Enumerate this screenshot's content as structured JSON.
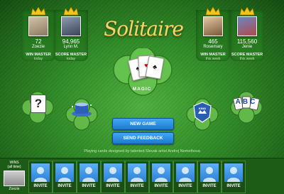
{
  "leaderboard": [
    {
      "score": "72",
      "name": "Zoezie",
      "title": "WIN MASTER",
      "sub": "today"
    },
    {
      "score": "94,965",
      "name": "Lynn M.",
      "title": "SCORE MASTER",
      "sub": "today"
    },
    {
      "score": "465",
      "name": "Rosemary",
      "title": "WIN MASTER",
      "sub": "this week"
    },
    {
      "score": "115,560",
      "name": "Jenie",
      "title": "SCORE MASTER",
      "sub": "this week"
    }
  ],
  "logo": {
    "main": "Solitaire",
    "sub": "MAGIC"
  },
  "buttons": {
    "new_game": "NEW GAME",
    "send_feedback": "SEND FEEDBACK"
  },
  "icons": {
    "help": "?",
    "badge": "KING",
    "abc": "ABC"
  },
  "credit": "Playing cards designed by talented Slovak artist Andrej Nemethova",
  "me": {
    "label": "WINS",
    "sub": "(all time)",
    "name": "Zoezie"
  },
  "invite_label": "INVITE",
  "invite_count": 9,
  "colors": {
    "accent": "#2f8a26",
    "button": "#2a8fe3",
    "gold": "#f3d66a"
  }
}
